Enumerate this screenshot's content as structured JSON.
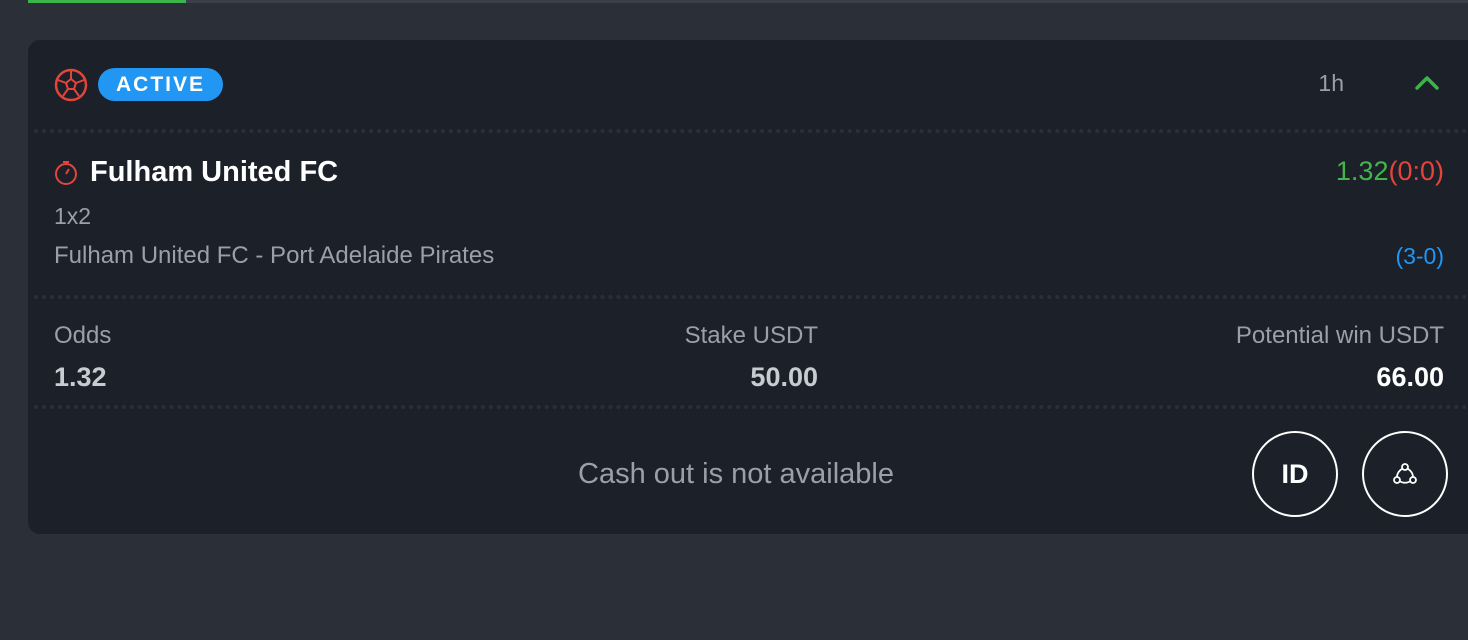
{
  "colors": {
    "page_bg": "#2b3038",
    "card_bg": "#1b2029",
    "accent_blue": "#2196f3",
    "accent_green": "#44b54c",
    "accent_red": "#e5443b"
  },
  "top_progress": {
    "fill_percent": 11
  },
  "bet": {
    "sport_icon": "soccer-ball-icon",
    "status": "ACTIVE",
    "time": "1h",
    "collapse_icon": "chevron-up-icon",
    "selection": {
      "icon": "timer-icon",
      "team": "Fulham United FC",
      "odds": "1.32",
      "odds_score": "(0:0)",
      "market": "1x2",
      "match": "Fulham United FC - Port Adelaide Pirates",
      "score": "(3-0)"
    },
    "summary": {
      "odds_label": "Odds",
      "odds_value": "1.32",
      "stake_label": "Stake USDT",
      "stake_value": "50.00",
      "win_label": "Potential win USDT",
      "win_value": "66.00"
    },
    "footer": {
      "cashout_text": "Cash out is not available",
      "id_button": "ID",
      "share_icon": "share-icon"
    }
  }
}
